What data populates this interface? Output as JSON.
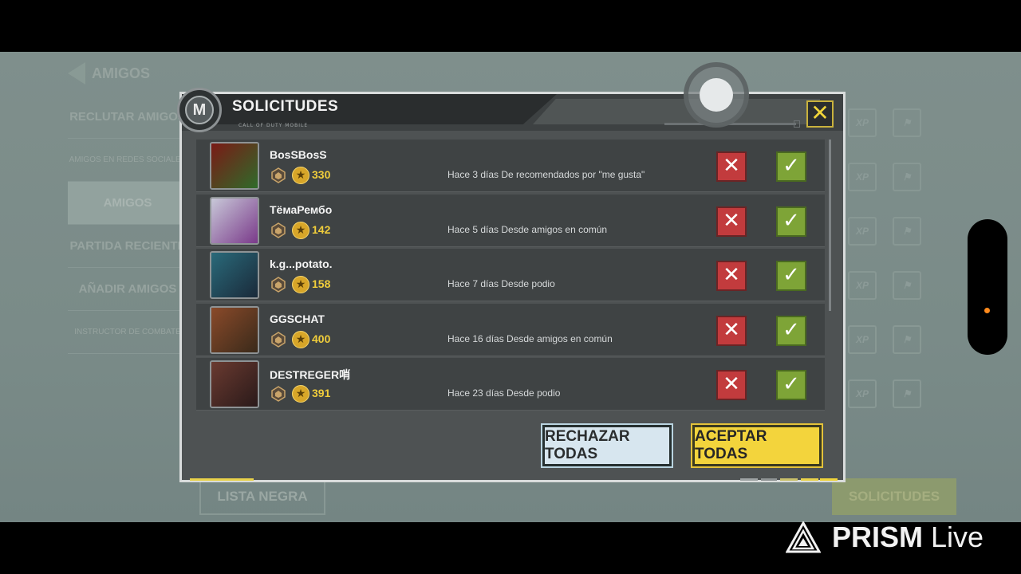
{
  "background": {
    "header_title": "AMIGOS",
    "menu": [
      {
        "label": "RECLUTAR AMIGOS",
        "small": false,
        "active": false
      },
      {
        "label": "AMIGOS EN REDES SOCIALES",
        "small": true,
        "active": false
      },
      {
        "label": "AMIGOS",
        "small": false,
        "active": true
      },
      {
        "label": "PARTIDA RECIENTE",
        "small": false,
        "active": false
      },
      {
        "label": "AÑADIR AMIGOS",
        "small": false,
        "active": false
      },
      {
        "label": "INSTRUCTOR DE COMBATE",
        "small": true,
        "active": false
      }
    ],
    "side_xp_label": "XP",
    "bottom_left_label": "LISTA NEGRA",
    "bottom_right_label": "SOLICITUDES"
  },
  "modal": {
    "title": "SOLICITUDES",
    "subtitle": "CALL OF DUTY MOBILE",
    "logo_letter": "M",
    "close_icon": "close-icon",
    "requests": [
      {
        "name": "BosSBosS",
        "level": "330",
        "source": "Hace 3 días De recomendados por \"me gusta\"",
        "avatar_colors": [
          "#7a1a16",
          "#2f6b2a"
        ]
      },
      {
        "name": "ТёмаРембо",
        "level": "142",
        "source": "Hace 5 días Desde amigos en común",
        "avatar_colors": [
          "#c8c8d8",
          "#7a3a8a"
        ]
      },
      {
        "name": "k.g...potato.",
        "level": "158",
        "source": "Hace 7 días Desde podio",
        "avatar_colors": [
          "#2a6a7a",
          "#1a2a3a"
        ]
      },
      {
        "name": "GGSCHAT",
        "level": "400",
        "source": "Hace 16 días Desde amigos en común",
        "avatar_colors": [
          "#8a4a2a",
          "#3a2a1a"
        ]
      },
      {
        "name": "DESTREGER哨",
        "level": "391",
        "source": "Hace 23 días Desde podio",
        "avatar_colors": [
          "#6a3a30",
          "#2a1a1a"
        ]
      }
    ],
    "reject_all_label": "RECHAZAR TODAS",
    "accept_all_label": "ACEPTAR TODAS"
  },
  "watermark": {
    "brand_bold": "PRISM",
    "brand_light": "Live"
  },
  "colors": {
    "accent_yellow": "#f3d43c",
    "reject_red": "#c23b3d",
    "accept_green": "#7ea437"
  }
}
